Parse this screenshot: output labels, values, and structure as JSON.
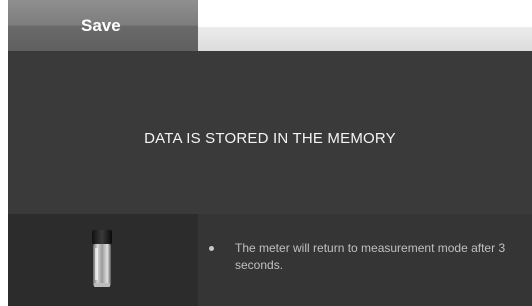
{
  "header": {
    "tab_label": "Save"
  },
  "main": {
    "message": "DATA IS STORED IN THE MEMORY"
  },
  "footer": {
    "icon": "sample-vial-icon",
    "note": "The meter will return to measurement mode after 3 seconds."
  }
}
